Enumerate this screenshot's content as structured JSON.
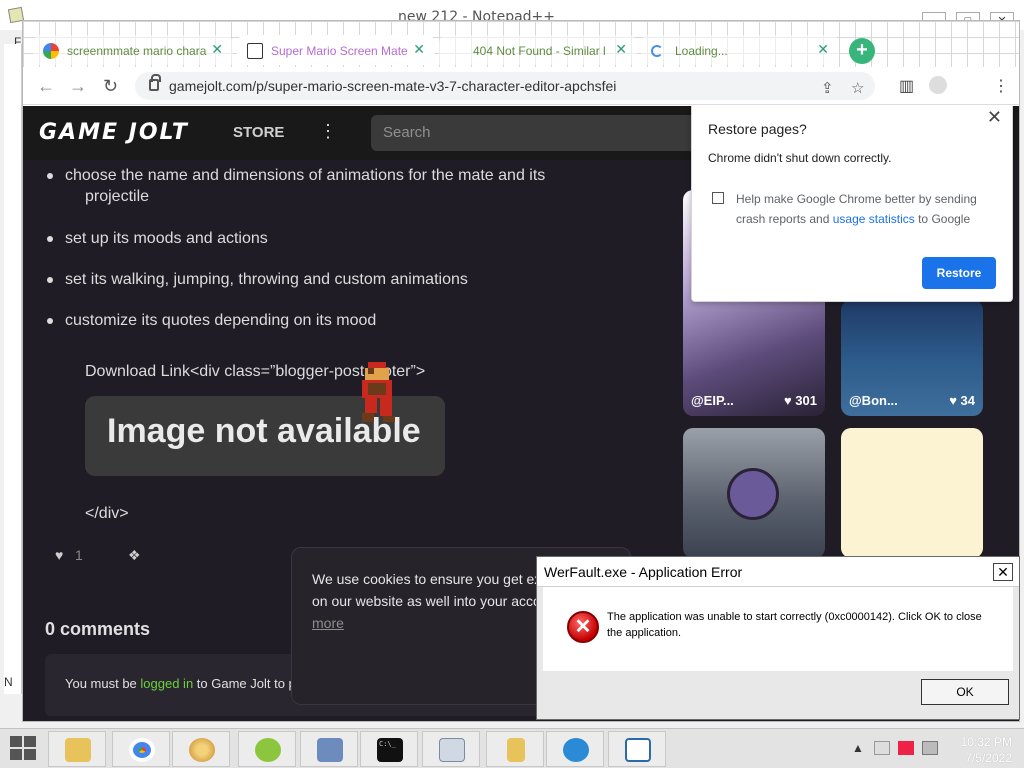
{
  "notepad": {
    "title": "new 212 - Notepad++",
    "menu_fragment": "F",
    "left_fragment": "N",
    "controls": [
      "–",
      "□",
      "✕"
    ]
  },
  "browser": {
    "tabs": [
      {
        "label": "screenmmate mario chara",
        "close": "✕",
        "favicon": "google-icon"
      },
      {
        "label": "Super Mario Screen Mate",
        "close": "✕",
        "favicon": "gamejolt-icon"
      },
      {
        "label": "404 Not Found - Similar l",
        "close": "✕",
        "favicon": "none"
      },
      {
        "label": "Loading...",
        "close": "✕",
        "favicon": "loading-icon"
      }
    ],
    "new_tab": "+",
    "url": "gamejolt.com/p/super-mario-screen-mate-v3-7-character-editor-apchsfei",
    "nav": {
      "back": "←",
      "forward": "→",
      "reload": "↻"
    }
  },
  "gamejolt": {
    "logo": "GAME JOLT",
    "store": "STORE",
    "more": "⋮",
    "search_placeholder": "Search",
    "bullets": [
      "choose the name and dimensions of animations for the mate and its",
      "projectile",
      "set up its moods and actions",
      "set its walking, jumping, throwing and custom animations",
      "customize its quotes depending on its mood"
    ],
    "download_line": "Download Link<div class=”blogger-post-footer”>",
    "image_not_available": "Image not available",
    "div_close": "</div>",
    "like_count": "1",
    "comments_header": "0 comments",
    "login_prefix": "You must be ",
    "login_link": "logged in",
    "login_suffix": " to Game Jolt to p",
    "cookie_text": "We use cookies to ensure you get experience on our website as well into your account.",
    "cookie_link": "Learn more",
    "cards": [
      {
        "user": "@EIP...",
        "likes": "301"
      },
      {
        "user": "@Bon...",
        "likes": "34"
      }
    ]
  },
  "restore_popup": {
    "title": "Restore pages?",
    "subtitle": "Chrome didn't shut down correctly.",
    "checkbox_text_1": "Help make Google Chrome better by sending crash reports and ",
    "checkbox_link": "usage statistics",
    "checkbox_text_2": " to Google",
    "button": "Restore",
    "close": "✕"
  },
  "werfault": {
    "title": "WerFault.exe - Application Error",
    "message": "The application was unable to start correctly (0xc0000142). Click OK to close the application.",
    "ok": "OK",
    "close": "✕",
    "error_glyph": "✕"
  },
  "taskbar": {
    "time": "10:32 PM",
    "date": "7/5/2022",
    "tray_arrow": "▲",
    "cmd_text": "C:\\_"
  },
  "colors": {
    "chrome_accent": "#1a73e8",
    "gamejolt_bg": "#1f1c26",
    "gamejolt_green": "#6bd13b",
    "tab_text": "#5e8c3f"
  }
}
